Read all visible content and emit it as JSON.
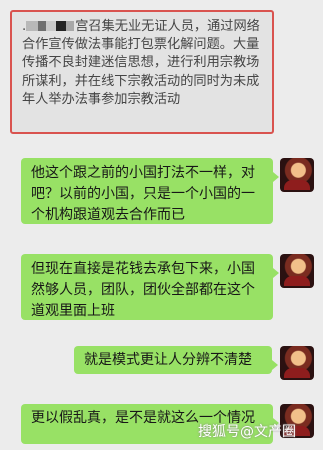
{
  "quote": {
    "prefix": ".",
    "text": "宫召集无业无证人员，通过网络合作宣传做法事能打包票化解问题。大量传播不良封建迷信思想，进行利用宗教场所谋利，并在线下宗教活动的同时为未成年人举办法事参加宗教活动"
  },
  "messages": [
    {
      "text": "他这个跟之前的小国打法不一样，对吧？以前的小国，只是一个小国的一个机构跟道观去合作而已"
    },
    {
      "text": "但现在直接是花钱去承包下来，小国然够人员，团队，团伙全部都在这个道观里面上班"
    },
    {
      "text": "就是模式更让人分辨不清楚"
    },
    {
      "text": "更以假乱真，是不是就这么一个情况"
    }
  ],
  "watermark": "搜狐号@文产圈",
  "colors": {
    "bubble": "#98e165",
    "quote_border": "#d9534f",
    "background": "#ececec"
  },
  "icons": [
    "user-avatar"
  ]
}
